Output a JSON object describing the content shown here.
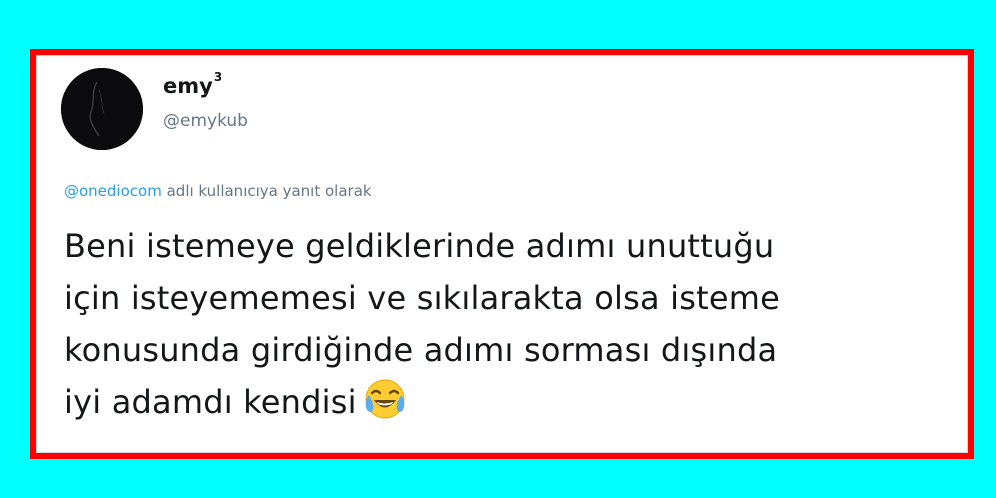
{
  "tweet": {
    "display_name": "emy",
    "display_name_sup": "3",
    "handle": "@emykub",
    "reply_mention": "@onediocom",
    "reply_suffix": "adlı kullanıcıya yanıt olarak",
    "text_lines": [
      "Beni istemeye geldiklerinde adımı unuttuğu",
      "için isteyememesi ve sıkılarakta olsa isteme",
      "konusunda girdiğinde adımı sorması dışında",
      "iyi adamdı kendisi"
    ],
    "emoji_icon": "face-with-tears-of-joy-icon"
  },
  "colors": {
    "background": "#00ffff",
    "frame": "#ff0000",
    "mention": "#2b9ee0",
    "secondary_text": "#657786",
    "primary_text": "#14171a"
  }
}
